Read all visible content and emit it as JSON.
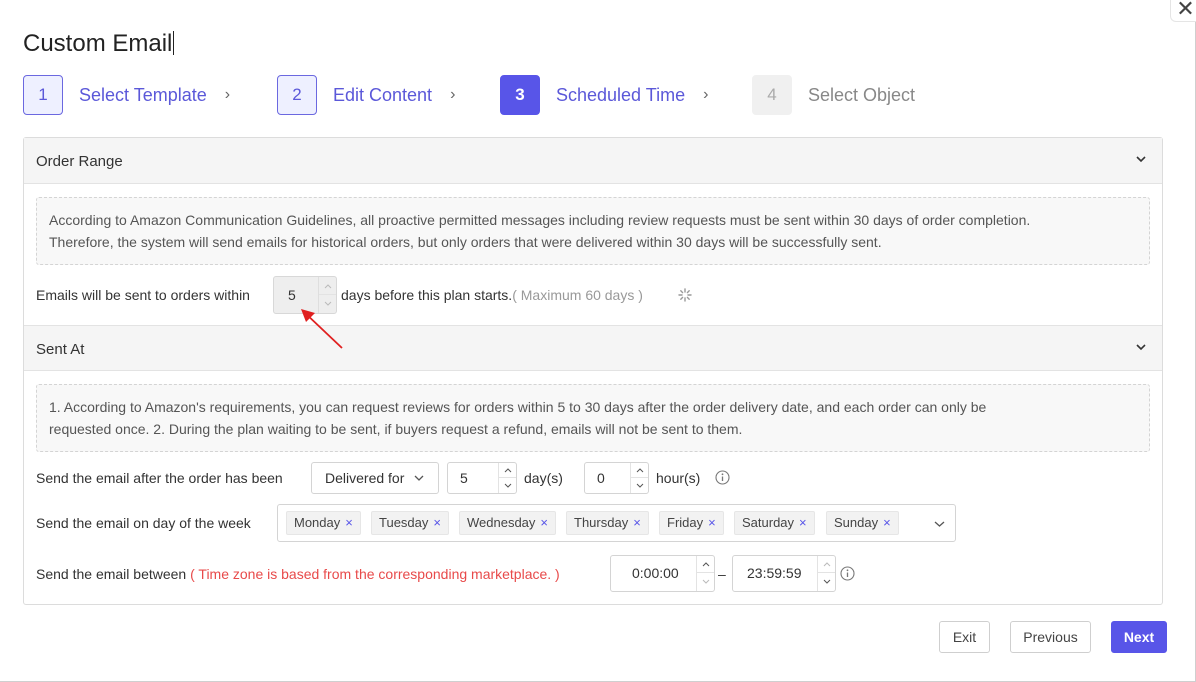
{
  "dialog": {
    "title": "Custom Email",
    "close_glyph": "✕"
  },
  "steps": [
    {
      "num": "1",
      "label": "Select Template",
      "state": "done"
    },
    {
      "num": "2",
      "label": "Edit Content",
      "state": "done"
    },
    {
      "num": "3",
      "label": "Scheduled Time",
      "state": "active"
    },
    {
      "num": "4",
      "label": "Select Object",
      "state": "disabled"
    }
  ],
  "step_separator": "›",
  "order_range": {
    "title": "Order Range",
    "notice_line1": "According to Amazon Communication Guidelines, all proactive permitted messages including review requests must be sent within 30 days of order completion.",
    "notice_line2": "Therefore, the system will send emails for historical orders, but only orders that were delivered within 30 days will be successfully sent.",
    "label_before": "Emails will be sent to orders within",
    "days_value": "5",
    "label_after": "days before this plan starts.",
    "max_hint": "( Maximum 60 days )"
  },
  "sent_at": {
    "title": "Sent At",
    "notice_line1": "1. According to Amazon's requirements, you can request reviews for orders within 5 to 30 days after the order delivery date, and each order can only be",
    "notice_line2": "requested once. 2. During the plan waiting to be sent, if buyers request a refund, emails will not be sent to them.",
    "after_label": "Send the email after the order has been",
    "status_select": "Delivered for",
    "days_value": "5",
    "days_unit": "day(s)",
    "hours_value": "0",
    "hours_unit": "hour(s)",
    "week_label": "Send the email on day of the week",
    "weekdays": [
      "Monday",
      "Tuesday",
      "Wednesday",
      "Thursday",
      "Friday",
      "Saturday",
      "Sunday"
    ],
    "tag_remove_glyph": "×",
    "between_label": "Send the email between",
    "timezone_note": "( Time zone is based from the corresponding marketplace. )",
    "start_time": "0:00:00",
    "range_sep": "–",
    "end_time": "23:59:59"
  },
  "footer": {
    "exit": "Exit",
    "previous": "Previous",
    "next": "Next"
  },
  "colors": {
    "accent": "#5855e8",
    "warning": "#e84a4a",
    "annotation_arrow": "#e02020"
  }
}
